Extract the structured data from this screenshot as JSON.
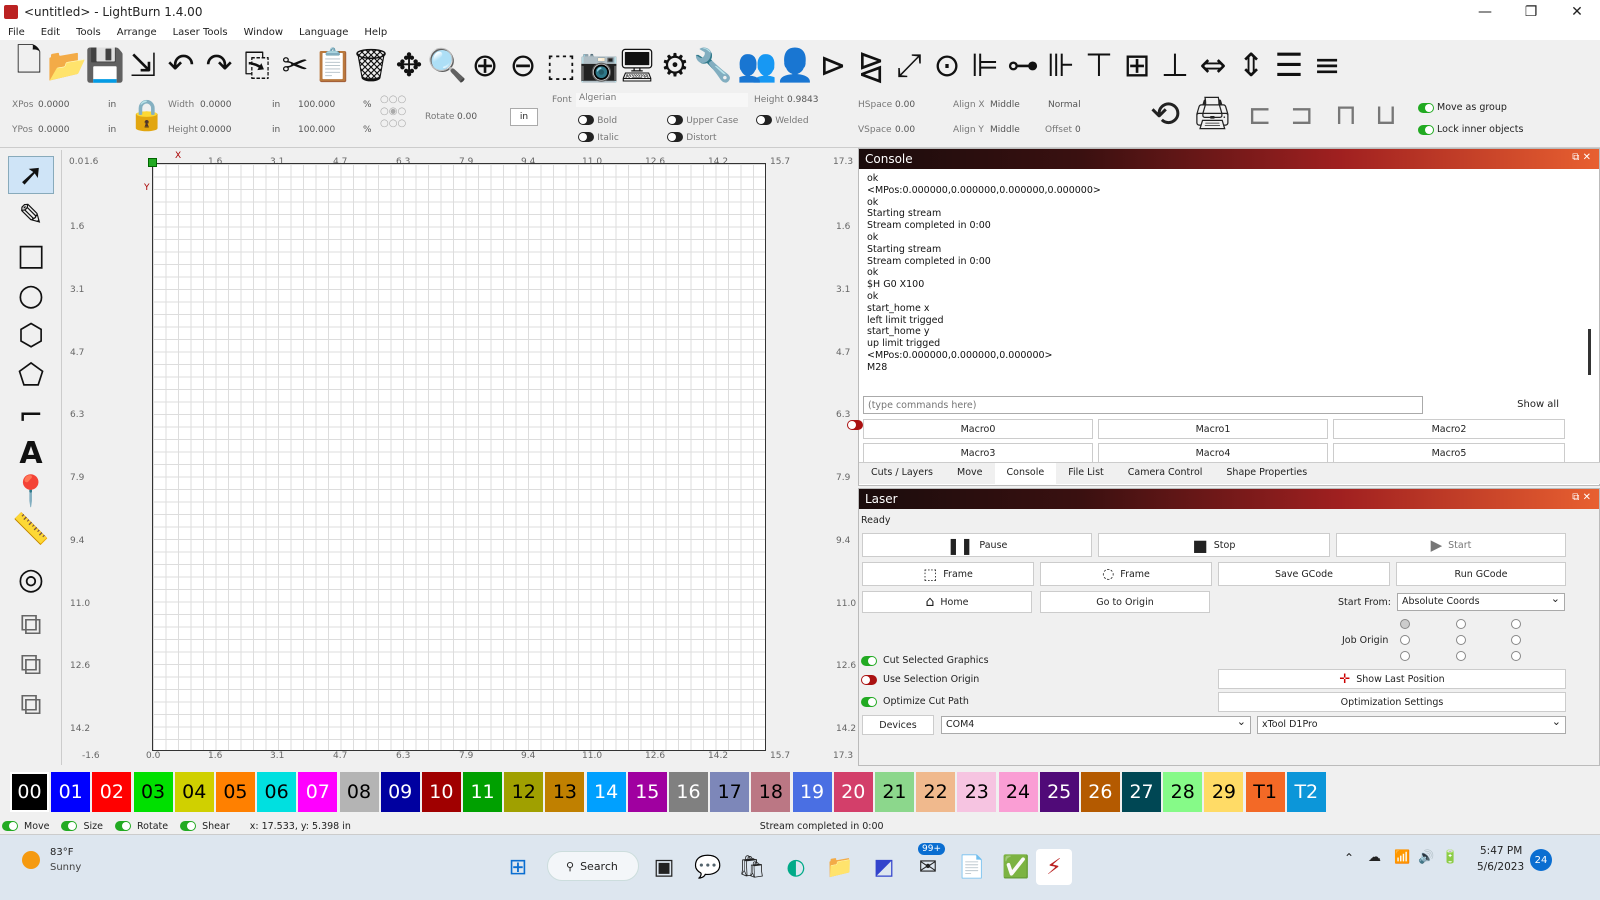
{
  "window": {
    "title": "<untitled> - LightBurn 1.4.00",
    "minimize": "—",
    "maximize": "❐",
    "close": "✕"
  },
  "menu": [
    "File",
    "Edit",
    "Tools",
    "Arrange",
    "Laser Tools",
    "Window",
    "Language",
    "Help"
  ],
  "toolbar_icons": [
    "new-file-icon",
    "open-folder-icon",
    "save-icon",
    "import-icon",
    "undo-icon",
    "redo-icon",
    "copy-icon",
    "cut-icon",
    "paste-icon",
    "delete-icon",
    "move-icon",
    "zoom-selection-icon",
    "zoom-in-icon",
    "zoom-out-icon",
    "zoom-frame-icon",
    "camera-icon",
    "monitor-icon",
    "settings-gear-icon",
    "tools-wrench-icon",
    "users-icon",
    "user-icon",
    "flip-icon",
    "mirror-icon",
    "rotate-icon",
    "target-icon",
    "align-left-icon",
    "align-center-icon",
    "align-right-icon",
    "align-top-icon",
    "align-middle-icon",
    "align-bottom-icon",
    "distribute-h-icon",
    "distribute-v-icon",
    "group-icon",
    "ungroup-icon"
  ],
  "props": {
    "xpos_label": "XPos",
    "xpos": "0.0000",
    "ypos_label": "YPos",
    "ypos": "0.0000",
    "unit": "in",
    "width_label": "Width",
    "width": "0.0000",
    "height_label": "Height",
    "height": "0.0000",
    "pct_w": "100.000",
    "pct_h": "100.000",
    "pct": "%",
    "rotate_label": "Rotate",
    "rotate": "0.00",
    "unit_btn": "in",
    "font_label": "Font",
    "font_value": "Algerian",
    "fheight_label": "Height",
    "fheight": "0.9843",
    "hspace_label": "HSpace",
    "hspace": "0.00",
    "vspace_label": "VSpace",
    "vspace": "0.00",
    "alignx_label": "Align X",
    "alignx": "Middle",
    "aligny_label": "Align Y",
    "aligny": "Middle",
    "mode": "Normal",
    "offset_label": "Offset",
    "offset": "0",
    "bold": "Bold",
    "italic": "Italic",
    "upper": "Upper Case",
    "distort": "Distort",
    "welded": "Welded",
    "move_group": "Move as group",
    "lock_inner": "Lock inner objects"
  },
  "rulers": {
    "top": [
      "1.6",
      "1.6",
      "3.1",
      "4.7",
      "6.3",
      "7.9",
      "9.4",
      "11.0",
      "12.6",
      "14.2",
      "15.7"
    ],
    "bottom": [
      "0.0",
      "1.6",
      "3.1",
      "4.7",
      "6.3",
      "7.9",
      "9.4",
      "11.0",
      "12.6",
      "14.2",
      "15.7"
    ],
    "left": [
      "0.0",
      "1.6",
      "3.1",
      "4.7",
      "6.3",
      "7.9",
      "9.4",
      "11.0",
      "12.6",
      "14.2"
    ],
    "right": [
      "17.3",
      "1.6",
      "3.1",
      "4.7",
      "6.3",
      "7.9",
      "9.4",
      "11.0",
      "12.6",
      "14.2",
      "17.3"
    ],
    "corner_bl": "-1.6",
    "corner_br": "15.7",
    "corner_tl": "0.0",
    "corner_tr": "17.3",
    "x": "X",
    "y": "Y"
  },
  "console": {
    "title": "Console",
    "lines": [
      "ok",
      "<MPos:0.000000,0.000000,0.000000,0.000000>",
      "ok",
      "Starting stream",
      "Stream completed in 0:00",
      "ok",
      "Starting stream",
      "Stream completed in 0:00",
      "ok",
      "$H G0 X100",
      "ok",
      "start_home x",
      "left limit trigged",
      "start_home y",
      "up limit trigged",
      "<MPos:0.000000,0.000000,0.000000>",
      "M28"
    ],
    "placeholder": "(type commands here)",
    "show_all": "Show all",
    "macros": [
      "Macro0",
      "Macro1",
      "Macro2",
      "Macro3",
      "Macro4",
      "Macro5"
    ],
    "tabs": [
      "Cuts / Layers",
      "Move",
      "Console",
      "File List",
      "Camera Control",
      "Shape Properties"
    ]
  },
  "laser": {
    "title": "Laser",
    "status": "Ready",
    "pause": "Pause",
    "stop": "Stop",
    "start": "Start",
    "frame1": "Frame",
    "frame2": "Frame",
    "save_gcode": "Save GCode",
    "run_gcode": "Run GCode",
    "home": "Home",
    "go_origin": "Go to Origin",
    "start_from_label": "Start From:",
    "start_from": "Absolute Coords",
    "job_origin": "Job Origin",
    "cut_selected": "Cut Selected Graphics",
    "use_selection": "Use Selection Origin",
    "optimize": "Optimize Cut Path",
    "show_last": "Show Last Position",
    "opt_settings": "Optimization Settings",
    "devices": "Devices",
    "port": "COM4",
    "machine": "xTool D1Pro"
  },
  "palette": [
    {
      "label": "00",
      "bg": "#000000",
      "fg": "#ffffff"
    },
    {
      "label": "01",
      "bg": "#0000ff",
      "fg": "#ffffff"
    },
    {
      "label": "02",
      "bg": "#ff0000",
      "fg": "#ffffff"
    },
    {
      "label": "03",
      "bg": "#00e000",
      "fg": "#000000"
    },
    {
      "label": "04",
      "bg": "#d0d000",
      "fg": "#000000"
    },
    {
      "label": "05",
      "bg": "#ff8000",
      "fg": "#000000"
    },
    {
      "label": "06",
      "bg": "#00e0e0",
      "fg": "#000000"
    },
    {
      "label": "07",
      "bg": "#ff00ff",
      "fg": "#ffffff"
    },
    {
      "label": "08",
      "bg": "#b4b4b4",
      "fg": "#000000"
    },
    {
      "label": "09",
      "bg": "#0000a0",
      "fg": "#ffffff"
    },
    {
      "label": "10",
      "bg": "#a00000",
      "fg": "#ffffff"
    },
    {
      "label": "11",
      "bg": "#00a000",
      "fg": "#ffffff"
    },
    {
      "label": "12",
      "bg": "#a0a000",
      "fg": "#000000"
    },
    {
      "label": "13",
      "bg": "#c08000",
      "fg": "#000000"
    },
    {
      "label": "14",
      "bg": "#00a0ff",
      "fg": "#ffffff"
    },
    {
      "label": "15",
      "bg": "#a000a0",
      "fg": "#ffffff"
    },
    {
      "label": "16",
      "bg": "#808080",
      "fg": "#ffffff"
    },
    {
      "label": "17",
      "bg": "#7d87b9",
      "fg": "#000000"
    },
    {
      "label": "18",
      "bg": "#bb7784",
      "fg": "#000000"
    },
    {
      "label": "19",
      "bg": "#4a6fe3",
      "fg": "#ffffff"
    },
    {
      "label": "20",
      "bg": "#d33f6a",
      "fg": "#ffffff"
    },
    {
      "label": "21",
      "bg": "#8cd78c",
      "fg": "#000000"
    },
    {
      "label": "22",
      "bg": "#f0b98d",
      "fg": "#000000"
    },
    {
      "label": "23",
      "bg": "#f6c4e1",
      "fg": "#000000"
    },
    {
      "label": "24",
      "bg": "#fa9ed4",
      "fg": "#000000"
    },
    {
      "label": "25",
      "bg": "#500a78",
      "fg": "#ffffff"
    },
    {
      "label": "26",
      "bg": "#b45a00",
      "fg": "#ffffff"
    },
    {
      "label": "27",
      "bg": "#004754",
      "fg": "#ffffff"
    },
    {
      "label": "28",
      "bg": "#86fa88",
      "fg": "#000000"
    },
    {
      "label": "29",
      "bg": "#ffdb66",
      "fg": "#000000"
    },
    {
      "label": "T1",
      "bg": "#f36926",
      "fg": "#000000"
    },
    {
      "label": "T2",
      "bg": "#0c96d9",
      "fg": "#ffffff"
    }
  ],
  "status": {
    "move": "Move",
    "size": "Size",
    "rotate": "Rotate",
    "shear": "Shear",
    "coords": "x: 17.533, y: 5.398 in",
    "msg": "Stream completed in 0:00"
  },
  "taskbar": {
    "temp": "83°F",
    "weather": "Sunny",
    "search": "Search",
    "badge": "99+",
    "time": "5:47 PM",
    "date": "5/6/2023",
    "notif": "24"
  }
}
